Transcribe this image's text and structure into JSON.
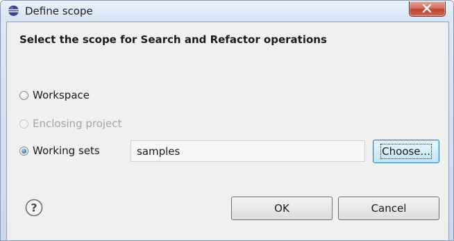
{
  "window": {
    "title": "Define scope",
    "close_label": "X"
  },
  "dialog": {
    "heading": "Select the scope for Search and Refactor operations",
    "options": [
      {
        "label": "Workspace",
        "selected": false,
        "enabled": true
      },
      {
        "label": "Enclosing project",
        "selected": false,
        "enabled": false
      },
      {
        "label": "Working sets",
        "selected": true,
        "enabled": true
      }
    ],
    "working_sets_value": "samples",
    "choose_label": "Choose...",
    "ok_label": "OK",
    "cancel_label": "Cancel",
    "help_glyph": "?"
  },
  "icons": {
    "app": "eclipse-icon",
    "close": "close-icon",
    "help": "help-icon"
  },
  "colors": {
    "accent": "#3c7fb1",
    "close_button": "#c0412c",
    "disabled_text": "#a3a3a3"
  }
}
